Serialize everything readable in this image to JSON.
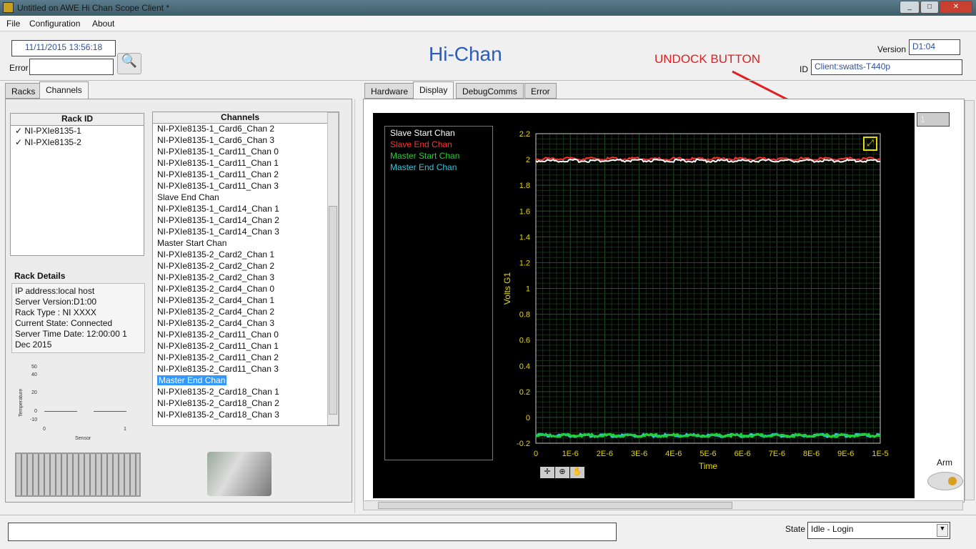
{
  "window": {
    "title": "Untitled on AWE Hi Chan Scope Client *"
  },
  "menu": [
    "File",
    "Configuration",
    "About"
  ],
  "header": {
    "datetime": "11/11/2015 13:56:18",
    "error_label": "Error",
    "error_value": "",
    "app_title": "Hi-Chan",
    "version_label": "Version",
    "version": "D1:04",
    "id_label": "ID",
    "id": "Client:swatts-T440p",
    "annotation": "UNDOCK BUTTON"
  },
  "left_tabs": [
    "Racks",
    "Channels"
  ],
  "racks": {
    "header": "Rack ID",
    "items": [
      "NI-PXIe8135-1",
      "NI-PXIe8135-2"
    ]
  },
  "rack_details": {
    "title": "Rack Details",
    "lines": [
      "IP address:local host",
      "Server Version:D1:00",
      "Rack Type : NI XXXX",
      "Current State: Connected",
      "Server Time Date: 12:00:00 1 Dec 2015"
    ]
  },
  "temp_chart": {
    "ylabel": "Temperature",
    "xlabel": "Sensor",
    "yticks": [
      "50",
      "40",
      "20",
      "0",
      "-10"
    ],
    "xticks": [
      "0",
      "1"
    ]
  },
  "channels": {
    "header": "Channels",
    "selected": "Master End Chan",
    "items": [
      "NI-PXIe8135-1_Card6_Chan 2",
      "NI-PXIe8135-1_Card6_Chan 3",
      "NI-PXIe8135-1_Card11_Chan 0",
      "NI-PXIe8135-1_Card11_Chan 1",
      "NI-PXIe8135-1_Card11_Chan 2",
      "NI-PXIe8135-1_Card11_Chan 3",
      "Slave End Chan",
      "NI-PXIe8135-1_Card14_Chan 1",
      "NI-PXIe8135-1_Card14_Chan 2",
      "NI-PXIe8135-1_Card14_Chan 3",
      "Master Start Chan",
      "NI-PXIe8135-2_Card2_Chan 1",
      "NI-PXIe8135-2_Card2_Chan 2",
      "NI-PXIe8135-2_Card2_Chan 3",
      "NI-PXIe8135-2_Card4_Chan 0",
      "NI-PXIe8135-2_Card4_Chan 1",
      "NI-PXIe8135-2_Card4_Chan 2",
      "NI-PXIe8135-2_Card4_Chan 3",
      "NI-PXIe8135-2_Card11_Chan 0",
      "NI-PXIe8135-2_Card11_Chan 1",
      "NI-PXIe8135-2_Card11_Chan 2",
      "NI-PXIe8135-2_Card11_Chan 3",
      "Master End Chan",
      "NI-PXIe8135-2_Card18_Chan 1",
      "NI-PXIe8135-2_Card18_Chan 2",
      "NI-PXIe8135-2_Card18_Chan 3"
    ]
  },
  "right_tabs": [
    "Hardware",
    "Display",
    "DebugComms",
    "Error"
  ],
  "graph_index": "1",
  "arm_label": "Arm",
  "status": {
    "message": "",
    "state_label": "State",
    "state_value": "Idle - Login"
  },
  "chart_data": {
    "type": "line",
    "xlabel": "Time",
    "ylabel": "Volts G1",
    "xlim": [
      0,
      1e-05
    ],
    "ylim": [
      -0.2,
      2.2
    ],
    "grid": true,
    "legend": "left",
    "xticks": [
      "0",
      "1E-6",
      "2E-6",
      "3E-6",
      "4E-6",
      "5E-6",
      "6E-6",
      "7E-6",
      "8E-6",
      "9E-6",
      "1E-5"
    ],
    "yticks": [
      "2.2",
      "2",
      "1.8",
      "1.6",
      "1.4",
      "1.2",
      "1",
      "0.8",
      "0.6",
      "0.4",
      "0.2",
      "0",
      "-0.2"
    ],
    "series": [
      {
        "name": "Slave Start Chan",
        "color": "#ffffff",
        "y": 1.99
      },
      {
        "name": "Slave End Chan",
        "color": "#ff3030",
        "y": 2.005
      },
      {
        "name": "Master Start Chan",
        "color": "#20d030",
        "y": -0.14
      },
      {
        "name": "Master End Chan",
        "color": "#30c8e0",
        "y": -0.14
      }
    ]
  }
}
